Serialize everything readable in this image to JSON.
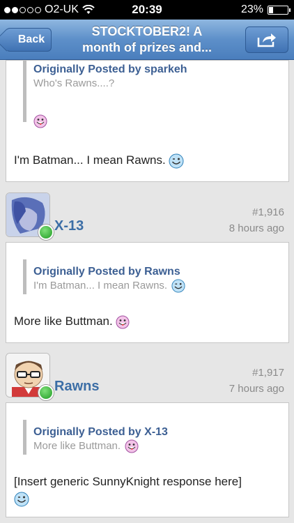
{
  "status_bar": {
    "carrier": "O2-UK",
    "time": "20:39",
    "battery": "23%",
    "battery_level": 0.23,
    "signal_bars_filled": 2,
    "signal_bars_total": 5
  },
  "nav": {
    "back_label": "Back",
    "title_line1": "STOCKTOBER2! A",
    "title_line2": "month of prizes and...",
    "share_icon": "share-icon"
  },
  "posts": [
    {
      "quote_author": "Originally Posted by sparkeh",
      "quote_text": "Who's Rawns....?",
      "text": "I'm Batman... I mean Rawns."
    },
    {
      "username": "X-13",
      "number": "#1,916",
      "time": "8 hours ago",
      "quote_author": "Originally Posted by Rawns",
      "quote_text": "I'm Batman... I mean Rawns.",
      "text": "More like Buttman."
    },
    {
      "username": "Rawns",
      "number": "#1,917",
      "time": "7 hours ago",
      "quote_author": "Originally Posted by X-13",
      "quote_text": "More like Buttman.",
      "text": "[Insert generic SunnyKnight response here]"
    }
  ],
  "colors": {
    "nav_blue": "#4a7ebd",
    "username": "#3c6ea6",
    "quote_title": "#3c5f93",
    "online": "#1f9a23"
  }
}
